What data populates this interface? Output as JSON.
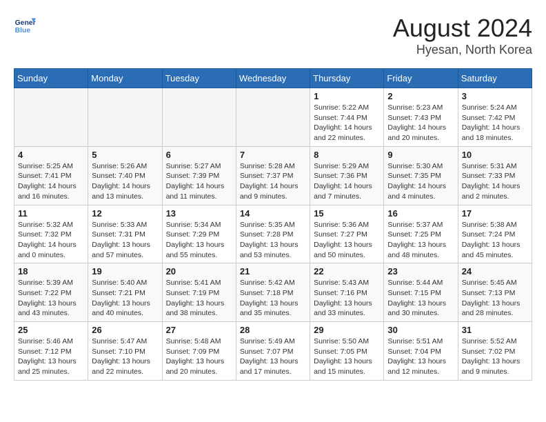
{
  "header": {
    "logo_line1": "General",
    "logo_line2": "Blue",
    "month_year": "August 2024",
    "location": "Hyesan, North Korea"
  },
  "weekdays": [
    "Sunday",
    "Monday",
    "Tuesday",
    "Wednesday",
    "Thursday",
    "Friday",
    "Saturday"
  ],
  "weeks": [
    [
      {
        "day": "",
        "empty": true
      },
      {
        "day": "",
        "empty": true
      },
      {
        "day": "",
        "empty": true
      },
      {
        "day": "",
        "empty": true
      },
      {
        "day": "1",
        "sunrise": "5:22 AM",
        "sunset": "7:44 PM",
        "daylight": "14 hours and 22 minutes."
      },
      {
        "day": "2",
        "sunrise": "5:23 AM",
        "sunset": "7:43 PM",
        "daylight": "14 hours and 20 minutes."
      },
      {
        "day": "3",
        "sunrise": "5:24 AM",
        "sunset": "7:42 PM",
        "daylight": "14 hours and 18 minutes."
      }
    ],
    [
      {
        "day": "4",
        "sunrise": "5:25 AM",
        "sunset": "7:41 PM",
        "daylight": "14 hours and 16 minutes."
      },
      {
        "day": "5",
        "sunrise": "5:26 AM",
        "sunset": "7:40 PM",
        "daylight": "14 hours and 13 minutes."
      },
      {
        "day": "6",
        "sunrise": "5:27 AM",
        "sunset": "7:39 PM",
        "daylight": "14 hours and 11 minutes."
      },
      {
        "day": "7",
        "sunrise": "5:28 AM",
        "sunset": "7:37 PM",
        "daylight": "14 hours and 9 minutes."
      },
      {
        "day": "8",
        "sunrise": "5:29 AM",
        "sunset": "7:36 PM",
        "daylight": "14 hours and 7 minutes."
      },
      {
        "day": "9",
        "sunrise": "5:30 AM",
        "sunset": "7:35 PM",
        "daylight": "14 hours and 4 minutes."
      },
      {
        "day": "10",
        "sunrise": "5:31 AM",
        "sunset": "7:33 PM",
        "daylight": "14 hours and 2 minutes."
      }
    ],
    [
      {
        "day": "11",
        "sunrise": "5:32 AM",
        "sunset": "7:32 PM",
        "daylight": "14 hours and 0 minutes."
      },
      {
        "day": "12",
        "sunrise": "5:33 AM",
        "sunset": "7:31 PM",
        "daylight": "13 hours and 57 minutes."
      },
      {
        "day": "13",
        "sunrise": "5:34 AM",
        "sunset": "7:29 PM",
        "daylight": "13 hours and 55 minutes."
      },
      {
        "day": "14",
        "sunrise": "5:35 AM",
        "sunset": "7:28 PM",
        "daylight": "13 hours and 53 minutes."
      },
      {
        "day": "15",
        "sunrise": "5:36 AM",
        "sunset": "7:27 PM",
        "daylight": "13 hours and 50 minutes."
      },
      {
        "day": "16",
        "sunrise": "5:37 AM",
        "sunset": "7:25 PM",
        "daylight": "13 hours and 48 minutes."
      },
      {
        "day": "17",
        "sunrise": "5:38 AM",
        "sunset": "7:24 PM",
        "daylight": "13 hours and 45 minutes."
      }
    ],
    [
      {
        "day": "18",
        "sunrise": "5:39 AM",
        "sunset": "7:22 PM",
        "daylight": "13 hours and 43 minutes."
      },
      {
        "day": "19",
        "sunrise": "5:40 AM",
        "sunset": "7:21 PM",
        "daylight": "13 hours and 40 minutes."
      },
      {
        "day": "20",
        "sunrise": "5:41 AM",
        "sunset": "7:19 PM",
        "daylight": "13 hours and 38 minutes."
      },
      {
        "day": "21",
        "sunrise": "5:42 AM",
        "sunset": "7:18 PM",
        "daylight": "13 hours and 35 minutes."
      },
      {
        "day": "22",
        "sunrise": "5:43 AM",
        "sunset": "7:16 PM",
        "daylight": "13 hours and 33 minutes."
      },
      {
        "day": "23",
        "sunrise": "5:44 AM",
        "sunset": "7:15 PM",
        "daylight": "13 hours and 30 minutes."
      },
      {
        "day": "24",
        "sunrise": "5:45 AM",
        "sunset": "7:13 PM",
        "daylight": "13 hours and 28 minutes."
      }
    ],
    [
      {
        "day": "25",
        "sunrise": "5:46 AM",
        "sunset": "7:12 PM",
        "daylight": "13 hours and 25 minutes."
      },
      {
        "day": "26",
        "sunrise": "5:47 AM",
        "sunset": "7:10 PM",
        "daylight": "13 hours and 22 minutes."
      },
      {
        "day": "27",
        "sunrise": "5:48 AM",
        "sunset": "7:09 PM",
        "daylight": "13 hours and 20 minutes."
      },
      {
        "day": "28",
        "sunrise": "5:49 AM",
        "sunset": "7:07 PM",
        "daylight": "13 hours and 17 minutes."
      },
      {
        "day": "29",
        "sunrise": "5:50 AM",
        "sunset": "7:05 PM",
        "daylight": "13 hours and 15 minutes."
      },
      {
        "day": "30",
        "sunrise": "5:51 AM",
        "sunset": "7:04 PM",
        "daylight": "13 hours and 12 minutes."
      },
      {
        "day": "31",
        "sunrise": "5:52 AM",
        "sunset": "7:02 PM",
        "daylight": "13 hours and 9 minutes."
      }
    ]
  ]
}
